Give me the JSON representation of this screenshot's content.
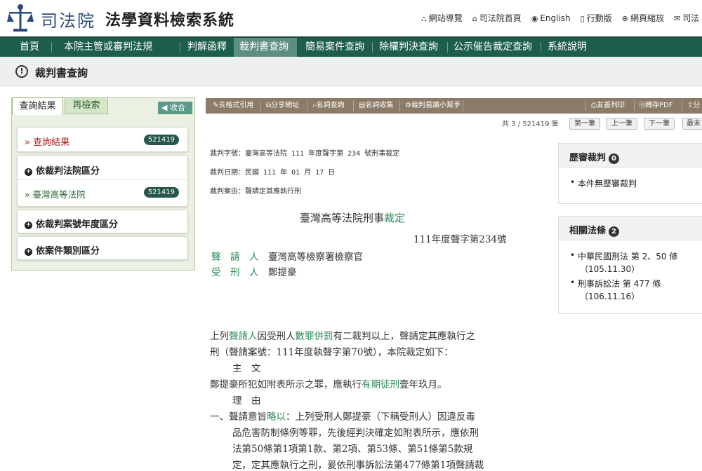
{
  "header": {
    "court_name": "司法院",
    "site_title": "法學資料檢索系統",
    "links": [
      {
        "icon": "sitemap-icon",
        "label": "網站導覽"
      },
      {
        "icon": "home-icon",
        "label": "司法院首頁"
      },
      {
        "icon": "globe-icon",
        "label": "English"
      },
      {
        "icon": "mobile-icon",
        "label": "行動版"
      },
      {
        "icon": "zoom-icon",
        "label": "網頁縮放"
      },
      {
        "icon": "mail-icon",
        "label": "司法"
      }
    ]
  },
  "nav": [
    "首頁",
    "本院主管或審判法規",
    "判解函釋",
    "裁判書查詢",
    "簡易案件查詢",
    "除權判決查詢",
    "公示催告裁定查詢",
    "系統說明"
  ],
  "page_title": "裁判書查詢",
  "sidebar": {
    "tab_results": "查詢結果",
    "tab_research": "再檢索",
    "collapse": "收合",
    "result_label": "» 查詢結果",
    "result_count": "521419",
    "court_group": "依裁判法院區分",
    "court_item": "» 臺灣高等法院",
    "court_count": "521419",
    "year_group": "依裁判案號年度區分",
    "type_group": "依案件類別區分"
  },
  "toolbar": [
    "去格式引用",
    "分享網址",
    "名詞查詢",
    "名詞收集",
    "裁判易讀小幫手",
    "友善列印",
    "轉存PDF",
    "分"
  ],
  "pager": {
    "info": "共 3 / 521419 筆",
    "first": "第一筆",
    "prev": "上一筆",
    "next": "下一筆",
    "last": "最末"
  },
  "meta": {
    "id": "裁判字號：臺灣高等法院 111 年度聲字第 234 號刑事裁定",
    "date": "裁判日期：民國 111 年 01 月 17 日",
    "cause": "裁判案由：聲請定其應執行刑"
  },
  "doc": {
    "heading_a": "臺灣高等法院刑事",
    "heading_b": "裁定",
    "case_no": "111年度聲字第234號",
    "p1_label": "聲　請　人",
    "p1_value": "臺灣高等檢察署檢察官",
    "p2_label": "受　刑　人",
    "p2_value": "鄭提豪",
    "l1a": "上列",
    "l1b": "聲請人",
    "l1c": "因受刑人",
    "l1d": "數罪併罰",
    "l1e": "有二裁判以上，聲請定其應執行之",
    "l2": "刑（聲請案號：111年度執聲字第70號），本院裁定如下：",
    "main_heading": "主　文",
    "l3a": "鄭提豪所犯如附表所示之罪，應執行",
    "l3b": "有期徒刑",
    "l3c": "壹年玖月。",
    "reason_heading": "理　由",
    "l4a": "一、聲請意旨",
    "l4b": "略以",
    "l4c": "：上列受刑人鄭提豪（下稱受刑人）因違反毒",
    "l5": "品危害防制條例等罪，先後經判決確定如附表所示，應依刑",
    "l6": "法第50條第1項第1款、第2項、第53條、第51條第5款規",
    "l7": "定，定其應執行之刑，爰依刑事訴訟法第477條第1項聲請裁"
  },
  "panel_history": {
    "title": "歷審裁判",
    "count": "0",
    "item": "本件無歷審裁判"
  },
  "panel_laws": {
    "title": "相關法條",
    "count": "2",
    "items": [
      {
        "name": "中華民國刑法 第 2、50 條",
        "date": "（105.11.30）"
      },
      {
        "name": "刑事訴訟法 第 477 條",
        "date": "（106.11.16）"
      }
    ]
  }
}
